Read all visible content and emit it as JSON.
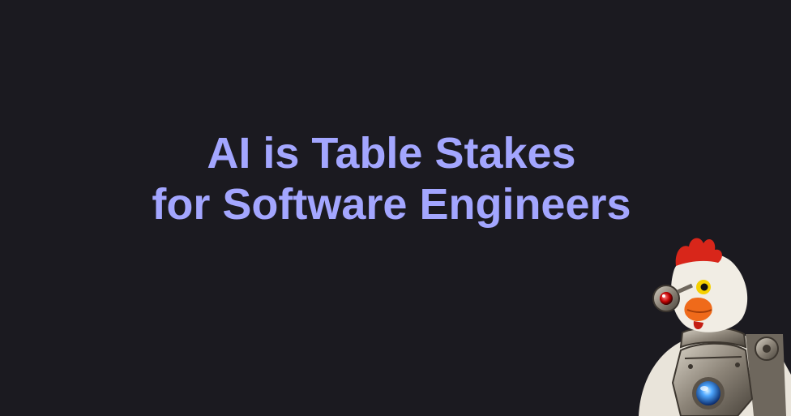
{
  "headline": {
    "line1": "AI is Table Stakes",
    "line2": "for Software Engineers"
  },
  "colors": {
    "background": "#1b1a20",
    "headline": "#a3a6ff"
  },
  "mascot": {
    "icon": "robot-chicken-icon"
  }
}
